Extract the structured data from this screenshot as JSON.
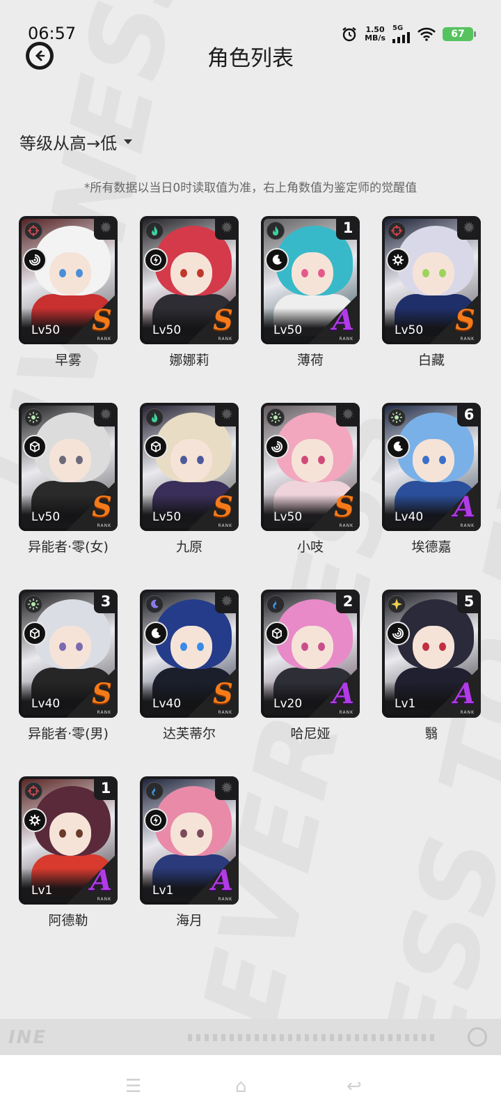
{
  "status": {
    "time": "06:57",
    "net_speed": "1.50",
    "net_unit": "MB/s",
    "signal": "5G",
    "battery": "67"
  },
  "header": {
    "title": "角色列表"
  },
  "sort": {
    "label": "等级从高→低"
  },
  "note": "*所有数据以当日0时读取值为准，右上角数值为鉴定师的觉醒值",
  "rank_tag": "RANK",
  "characters": [
    {
      "name": "早雾",
      "level": "Lv50",
      "rank": "S",
      "awaken": "",
      "element_icon": "target-icon",
      "class_icon": "vortex-icon",
      "element_color": "#e0474c",
      "hair": "#f3f3f3",
      "eye": "#4a8fd8",
      "outfit": "#c93030"
    },
    {
      "name": "娜娜莉",
      "level": "Lv50",
      "rank": "S",
      "awaken": "",
      "element_icon": "flame-icon",
      "class_icon": "lightning-icon",
      "element_color": "#3fcf9a",
      "hair": "#d43a4a",
      "eye": "#c0392b",
      "outfit": "#2d2d33"
    },
    {
      "name": "薄荷",
      "level": "Lv50",
      "rank": "A",
      "awaken": "1",
      "element_icon": "flame-icon",
      "class_icon": "crescent-icon",
      "element_color": "#3fcf9a",
      "hair": "#37b9c9",
      "eye": "#e35a8a",
      "outfit": "#eeeeee"
    },
    {
      "name": "白藏",
      "level": "Lv50",
      "rank": "S",
      "awaken": "",
      "element_icon": "target-icon",
      "class_icon": "gear-icon",
      "element_color": "#e0474c",
      "hair": "#d8d8e8",
      "eye": "#9bd45a",
      "outfit": "#1f2f6a"
    },
    {
      "name": "异能者·零(女)",
      "level": "Lv50",
      "rank": "S",
      "awaken": "",
      "element_icon": "sun-icon",
      "class_icon": "cube-icon",
      "element_color": "#b9e8b0",
      "hair": "#dcdcdc",
      "eye": "#6a6a7a",
      "outfit": "#2a2a2a"
    },
    {
      "name": "九原",
      "level": "Lv50",
      "rank": "S",
      "awaken": "",
      "element_icon": "flame-icon",
      "class_icon": "cube-icon",
      "element_color": "#3fcf9a",
      "hair": "#e8dcc4",
      "eye": "#4c5a9a",
      "outfit": "#3a2f5a"
    },
    {
      "name": "小吱",
      "level": "Lv50",
      "rank": "S",
      "awaken": "",
      "element_icon": "sun-icon",
      "class_icon": "vortex-icon",
      "element_color": "#b9e8b0",
      "hair": "#f2a7bf",
      "eye": "#d04a7a",
      "outfit": "#f0d4dc"
    },
    {
      "name": "埃德嘉",
      "level": "Lv40",
      "rank": "A",
      "awaken": "6",
      "element_icon": "sun-icon",
      "class_icon": "crescent-icon",
      "element_color": "#b9e8b0",
      "hair": "#7ab0e8",
      "eye": "#3a70c8",
      "outfit": "#2b4f9a"
    },
    {
      "name": "异能者·零(男)",
      "level": "Lv40",
      "rank": "S",
      "awaken": "3",
      "element_icon": "sun-icon",
      "class_icon": "cube-icon",
      "element_color": "#b9e8b0",
      "hair": "#dadde4",
      "eye": "#7a6ab0",
      "outfit": "#262626"
    },
    {
      "name": "达芙蒂尔",
      "level": "Lv40",
      "rank": "S",
      "awaken": "",
      "element_icon": "moon-icon",
      "class_icon": "crescent-icon",
      "element_color": "#8a7ae8",
      "hair": "#243c8a",
      "eye": "#3a8ae8",
      "outfit": "#1b1f2c"
    },
    {
      "name": "哈尼娅",
      "level": "Lv20",
      "rank": "A",
      "awaken": "2",
      "element_icon": "wave-icon",
      "class_icon": "cube-icon",
      "element_color": "#3a9ae8",
      "hair": "#e88ac8",
      "eye": "#c8508a",
      "outfit": "#2e2e36"
    },
    {
      "name": "翳",
      "level": "Lv1",
      "rank": "A",
      "awaken": "5",
      "element_icon": "star-icon",
      "class_icon": "vortex-icon",
      "element_color": "#f0d04a",
      "hair": "#2a2a3a",
      "eye": "#c03040",
      "outfit": "#202030"
    },
    {
      "name": "阿德勒",
      "level": "Lv1",
      "rank": "A",
      "awaken": "1",
      "element_icon": "target-icon",
      "class_icon": "gear-icon",
      "element_color": "#e0474c",
      "hair": "#5a2a3a",
      "eye": "#6a3a2a",
      "outfit": "#d83a2e"
    },
    {
      "name": "海月",
      "level": "Lv1",
      "rank": "A",
      "awaken": "",
      "element_icon": "wave-icon",
      "class_icon": "lightning-icon",
      "element_color": "#3a9ae8",
      "hair": "#e88aa8",
      "eye": "#7a4a5a",
      "outfit": "#2a3a7a"
    }
  ]
}
